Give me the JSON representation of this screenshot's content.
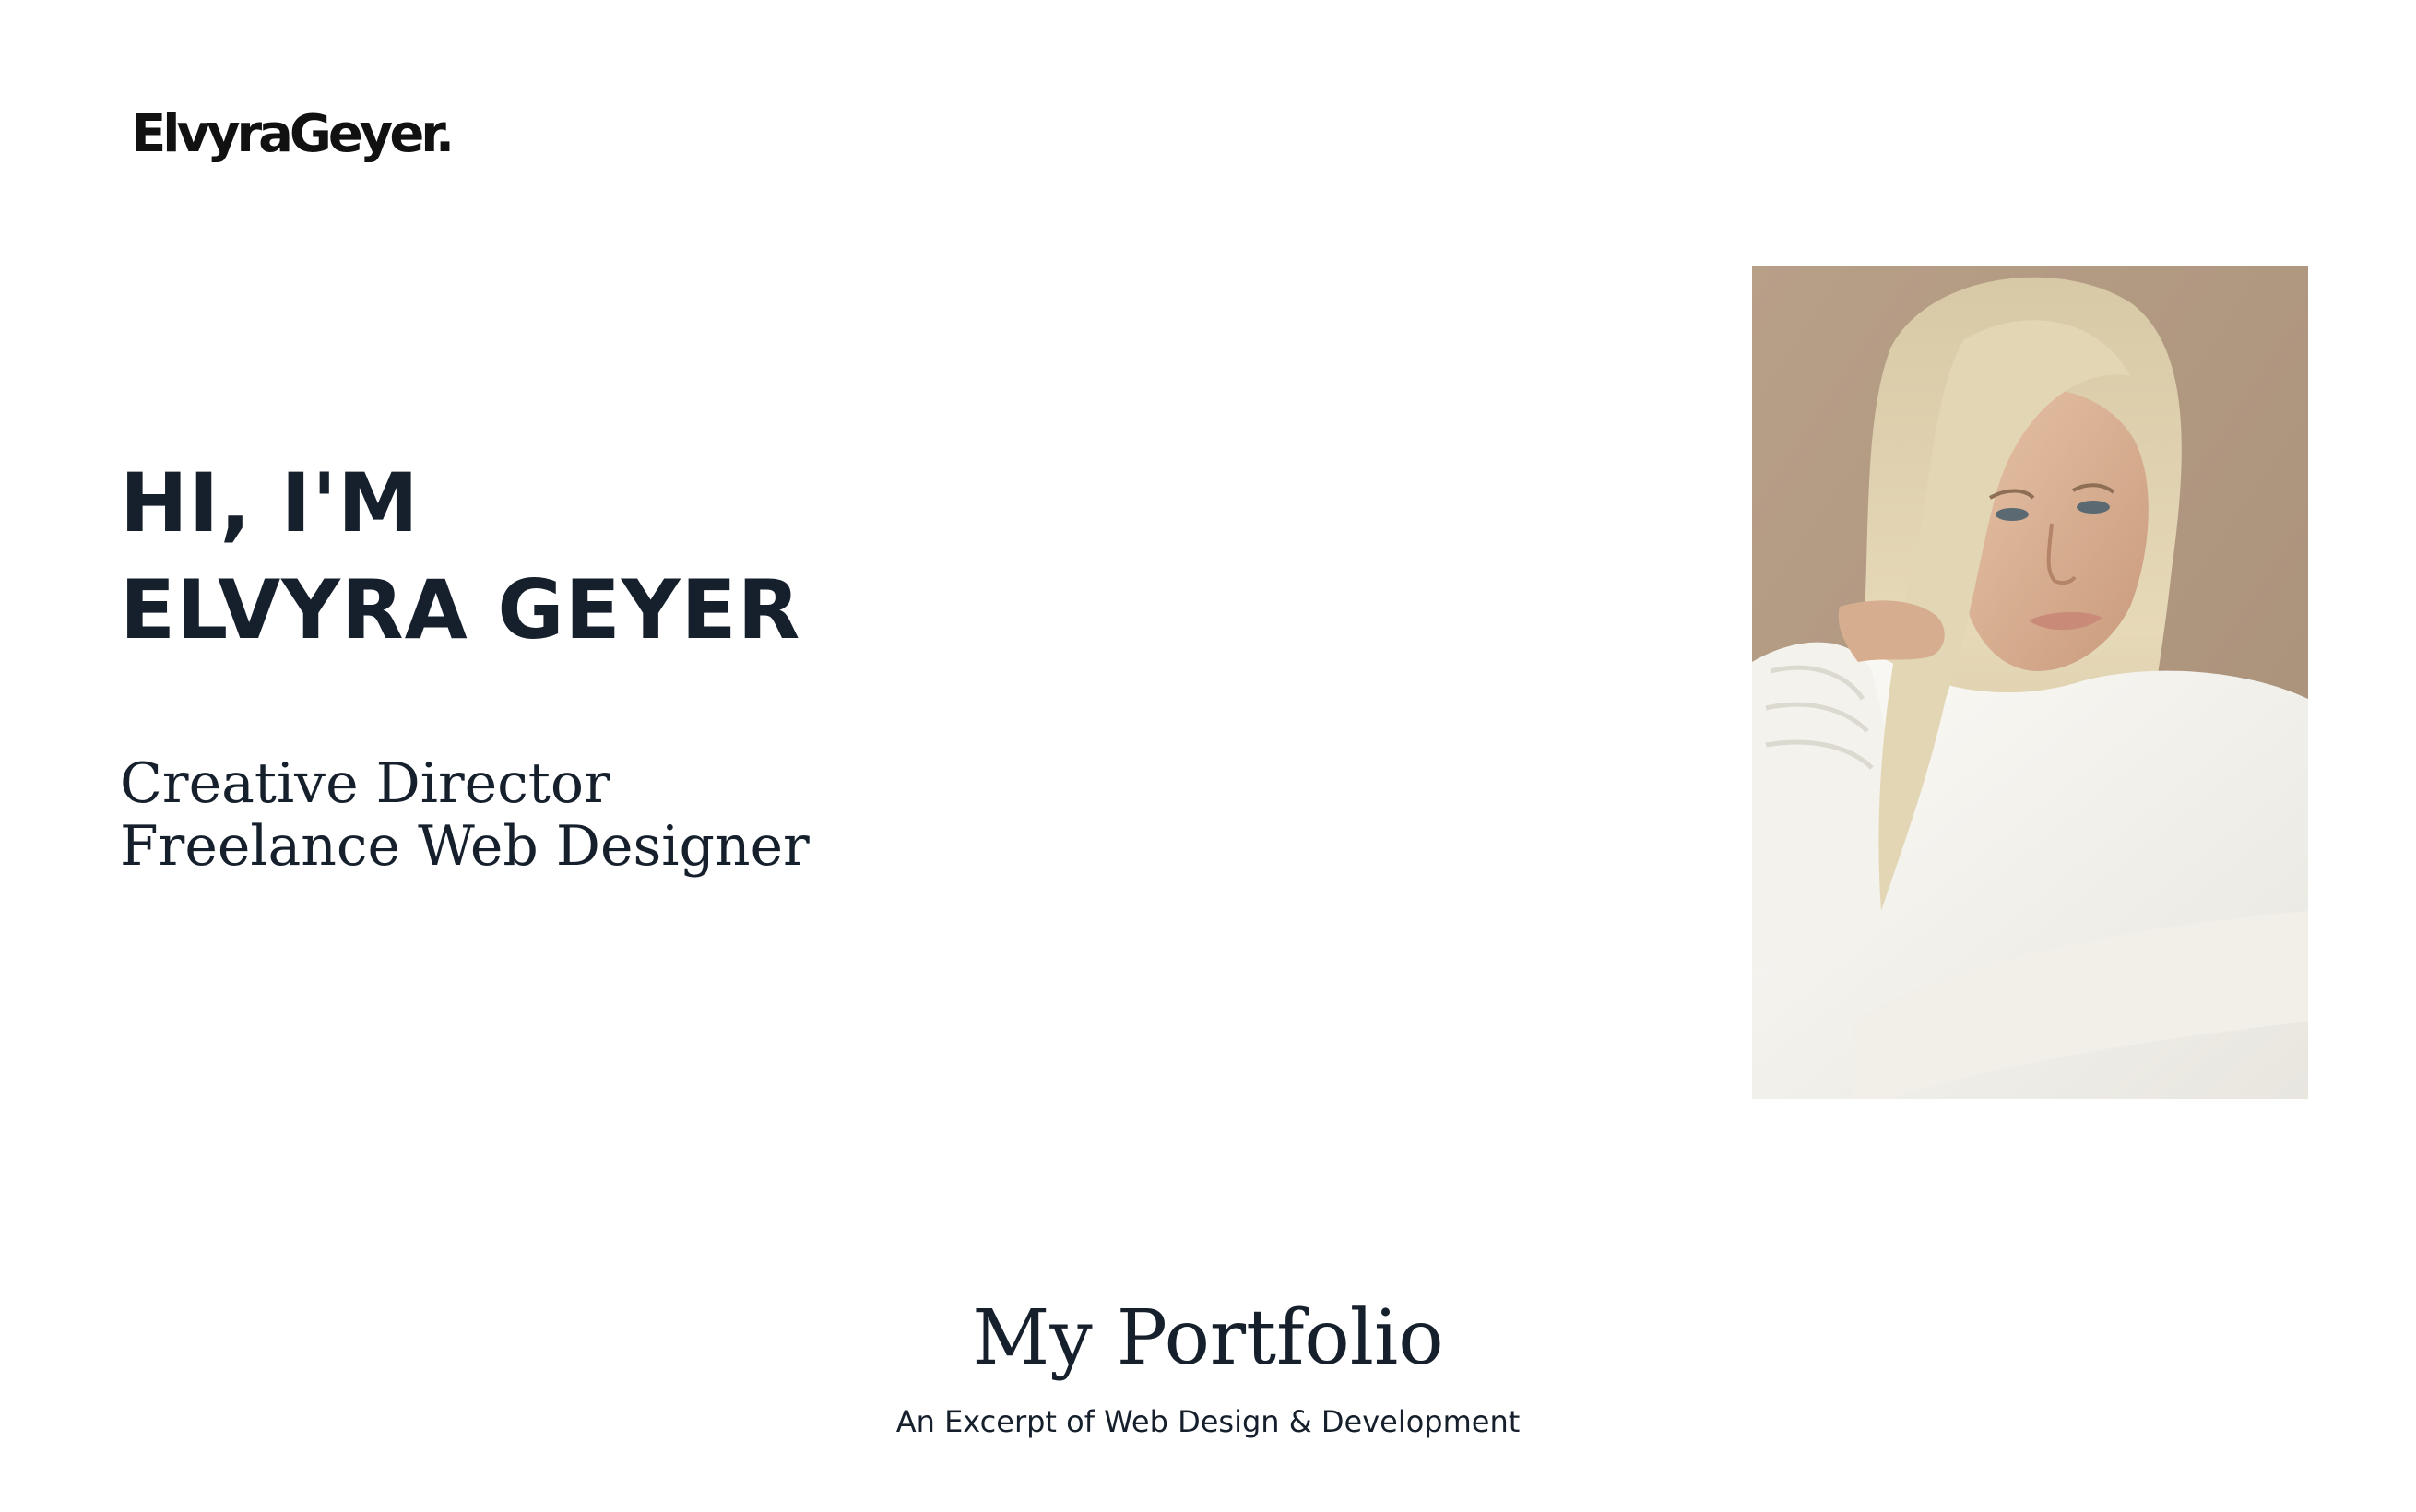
{
  "header": {
    "logo_text": "ElvyraGeyer."
  },
  "hero": {
    "greeting": "HI, I'M",
    "name": "ELVYRA GEYER",
    "roles": [
      "Creative Director",
      "Freelance Web Designer"
    ],
    "portrait_alt": "Portrait of Elvyra Geyer"
  },
  "portfolio": {
    "title": "My Portfolio",
    "subtitle": "An Excerpt of Web Design & Development"
  },
  "colors": {
    "text": "#16202c",
    "background": "#ffffff",
    "portrait_backdrop": "#b49c86"
  }
}
